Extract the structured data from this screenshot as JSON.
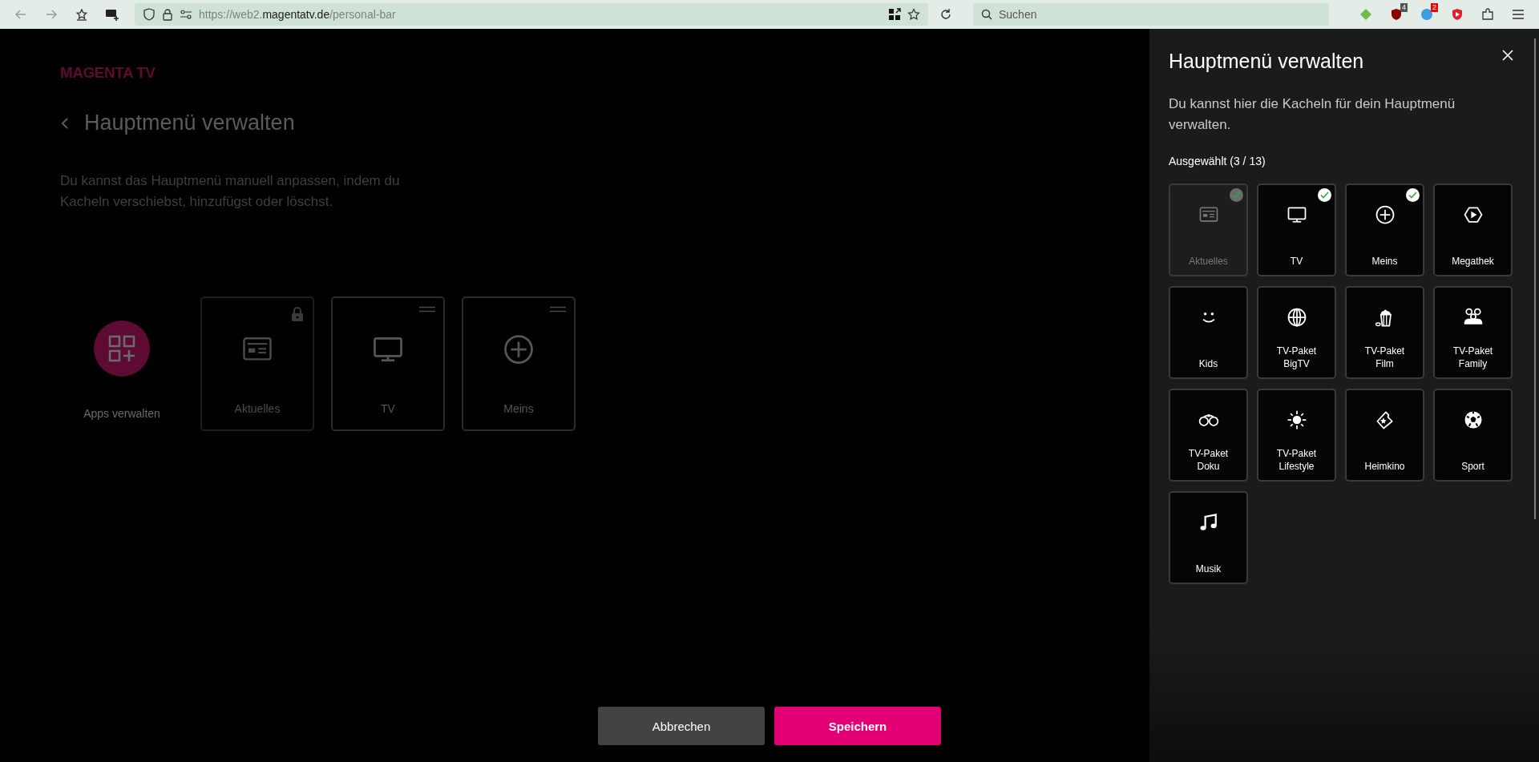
{
  "browser": {
    "url": {
      "scheme": "https://web2.",
      "domain": "magentatv.de",
      "path": "/personal-bar"
    },
    "search": {
      "placeholder": "Suchen"
    },
    "extension_badges": [
      "4",
      "2"
    ]
  },
  "page": {
    "logo": "MAGENTA TV",
    "title": "Hauptmenü verwalten",
    "description": "Du kannst das Hauptmenü manuell anpassen, indem du Kacheln verschiebst, hinzufügst oder löschst.",
    "apps_label": "Apps verwalten",
    "tiles": [
      {
        "label": "Aktuelles",
        "kind": "news",
        "locked": true
      },
      {
        "label": "TV",
        "kind": "tv",
        "locked": false
      },
      {
        "label": "Meins",
        "kind": "plus",
        "locked": false
      }
    ]
  },
  "buttons": {
    "cancel": "Abbrechen",
    "save": "Speichern"
  },
  "panel": {
    "title": "Hauptmenü verwalten",
    "description": "Du kannst hier die Kacheln für dein Hauptmenü verwalten.",
    "selected_count": "Ausgewählt (3 / 13)",
    "tiles": [
      {
        "label": "Aktuelles",
        "kind": "news",
        "checked": true,
        "disabled": true
      },
      {
        "label": "TV",
        "kind": "tv",
        "checked": true,
        "disabled": false
      },
      {
        "label": "Meins",
        "kind": "plus",
        "checked": true,
        "disabled": false
      },
      {
        "label": "Megathek",
        "kind": "play",
        "checked": false,
        "disabled": false
      },
      {
        "label": "Kids",
        "kind": "smile",
        "checked": false,
        "disabled": false
      },
      {
        "label": "TV-Paket BigTV",
        "kind": "globe",
        "checked": false,
        "disabled": false
      },
      {
        "label": "TV-Paket Film",
        "kind": "popcorn",
        "checked": false,
        "disabled": false
      },
      {
        "label": "TV-Paket Family",
        "kind": "family",
        "checked": false,
        "disabled": false
      },
      {
        "label": "TV-Paket Doku",
        "kind": "binoculars",
        "checked": false,
        "disabled": false
      },
      {
        "label": "TV-Paket Lifestyle",
        "kind": "sun",
        "checked": false,
        "disabled": false
      },
      {
        "label": "Heimkino",
        "kind": "ticket",
        "checked": false,
        "disabled": false
      },
      {
        "label": "Sport",
        "kind": "ball",
        "checked": false,
        "disabled": false
      },
      {
        "label": "Musik",
        "kind": "music",
        "checked": false,
        "disabled": false
      }
    ]
  }
}
